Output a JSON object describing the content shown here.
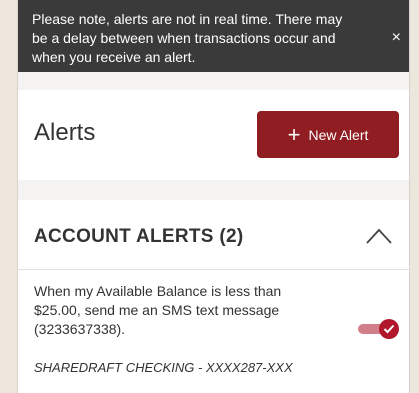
{
  "notice": {
    "lines": [
      "Please note, alerts are not in real time. There may",
      "be a delay between when transactions occur and",
      "when you receive an alert."
    ],
    "close_glyph": "×"
  },
  "header": {
    "title": "Alerts",
    "new_alert_label": "New Alert",
    "plus_glyph": "+"
  },
  "section": {
    "title": "ACCOUNT ALERTS (2)",
    "collapse_icon": "chevron-up-icon"
  },
  "alerts": [
    {
      "text_lines": [
        "When my Available Balance is less than",
        "$25.00, send me an SMS text message",
        "(3233637338)."
      ],
      "enabled": true,
      "account": "SHAREDRAFT CHECKING - XXXX287-XXX"
    }
  ],
  "colors": {
    "notice_bg": "#3a3a3a",
    "brand": "#8f1d21",
    "toggle_on": "#b0172a",
    "toggle_track": "#d27e8a"
  }
}
